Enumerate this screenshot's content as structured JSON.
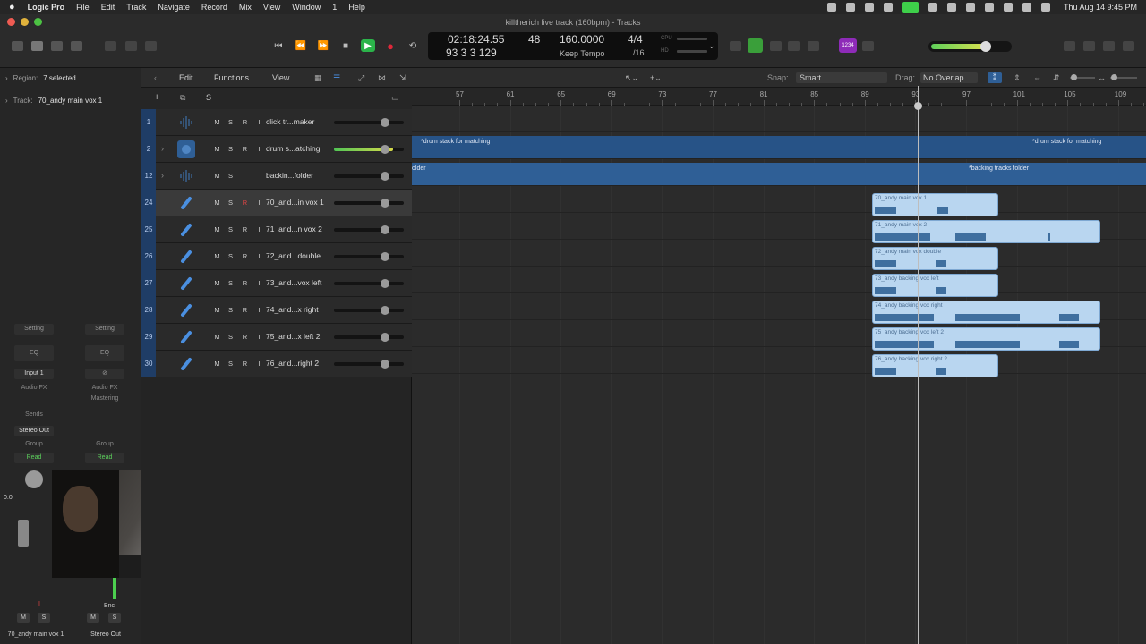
{
  "menubar": {
    "apple": "",
    "items": [
      "Logic Pro",
      "File",
      "Edit",
      "Track",
      "Navigate",
      "Record",
      "Mix",
      "View",
      "Window",
      "1",
      "Help"
    ],
    "clock": "Thu Aug 14  9:45 PM"
  },
  "window": {
    "title": "killtherich live track (160bpm) - Tracks"
  },
  "lcd": {
    "time": "02:18:24.55",
    "beats": "93  3  3  129",
    "bar_count": "48",
    "tempo": "160.0000",
    "tempo_mode": "Keep Tempo",
    "signature": "4/4",
    "division": "/16",
    "cpu_label": "CPU",
    "hd_label": "HD"
  },
  "purple_tag": "1234",
  "inspector": {
    "region_label": "Region:",
    "region_value": "7 selected",
    "track_label": "Track:",
    "track_value": "70_andy main vox 1",
    "strip1": {
      "setting": "Setting",
      "eq": "EQ",
      "input": "Input 1",
      "audio_fx": "Audio FX",
      "sends": "Sends",
      "output": "Stereo Out",
      "group": "Group",
      "auto": "Read",
      "pan": "0.0",
      "mute": "M",
      "solo": "S",
      "name": "70_andy main vox 1",
      "rec": "I"
    },
    "strip2": {
      "setting": "Setting",
      "eq": "EQ",
      "audio_fx": "Audio FX",
      "mastering": "Mastering",
      "group": "Group",
      "auto": "Read",
      "bnc": "Bnc",
      "mute": "M",
      "solo": "S",
      "name": "Stereo Out"
    }
  },
  "header_bar": {
    "edit": "Edit",
    "functions": "Functions",
    "view": "View",
    "add": "+",
    "solo": "S"
  },
  "tracks_bar": {
    "snap_label": "Snap:",
    "snap_value": "Smart",
    "drag_label": "Drag:",
    "drag_value": "No Overlap"
  },
  "tracks": [
    {
      "num": "1",
      "name": "click tr...maker",
      "icon": "waveform-icon",
      "rec": false,
      "selected": false,
      "folder": false,
      "level_pct": 0
    },
    {
      "num": "2",
      "name": "drum s...atching",
      "icon": "folder-stack-icon",
      "rec": false,
      "selected": false,
      "folder": true,
      "level_pct": 85
    },
    {
      "num": "12",
      "name": "backin...folder",
      "icon": "waveform-icon",
      "rec": false,
      "selected": false,
      "folder": true,
      "level_pct": 0
    },
    {
      "num": "24",
      "name": "70_and...in vox 1",
      "icon": "mic-icon",
      "rec": true,
      "selected": true,
      "folder": false,
      "level_pct": 0
    },
    {
      "num": "25",
      "name": "71_and...n vox 2",
      "icon": "mic-icon",
      "rec": false,
      "selected": false,
      "folder": false,
      "level_pct": 0
    },
    {
      "num": "26",
      "name": "72_and...double",
      "icon": "mic-icon",
      "rec": false,
      "selected": false,
      "folder": false,
      "level_pct": 0
    },
    {
      "num": "27",
      "name": "73_and...vox left",
      "icon": "mic-icon",
      "rec": false,
      "selected": false,
      "folder": false,
      "level_pct": 0
    },
    {
      "num": "28",
      "name": "74_and...x right",
      "icon": "mic-icon",
      "rec": false,
      "selected": false,
      "folder": false,
      "level_pct": 0
    },
    {
      "num": "29",
      "name": "75_and...x left 2",
      "icon": "mic-icon",
      "rec": false,
      "selected": false,
      "folder": false,
      "level_pct": 0
    },
    {
      "num": "30",
      "name": "76_and...right 2",
      "icon": "mic-icon",
      "rec": false,
      "selected": false,
      "folder": false,
      "level_pct": 0
    }
  ],
  "track_buttons": {
    "m": "M",
    "s": "S",
    "r": "R",
    "i": "I"
  },
  "ruler": [
    "57",
    "61",
    "65",
    "69",
    "73",
    "77",
    "81",
    "85",
    "89",
    "93",
    "97",
    "101",
    "105",
    "109"
  ],
  "lanes": {
    "drum_stack_a": "*drum stack for matching",
    "drum_stack_b": "*drum stack for matching",
    "backing_a": "older",
    "backing_b": "*backing tracks folder"
  },
  "regions": [
    {
      "label": "70_andy main vox 1"
    },
    {
      "label": "71_andy main vox 2"
    },
    {
      "label": "72_andy main vox double"
    },
    {
      "label": "73_andy backing vox left"
    },
    {
      "label": "74_andy backing vox right"
    },
    {
      "label": "75_andy backing vox left 2"
    },
    {
      "label": "76_andy backing vox right 2"
    }
  ],
  "colors": {
    "track_num_bg": "#1f3d66",
    "region_fill": "#b9d6f0",
    "folder_lane": "#275387",
    "play": "#2bb34a",
    "record": "#e0283a",
    "purple_tag": "#8e2bb8"
  }
}
